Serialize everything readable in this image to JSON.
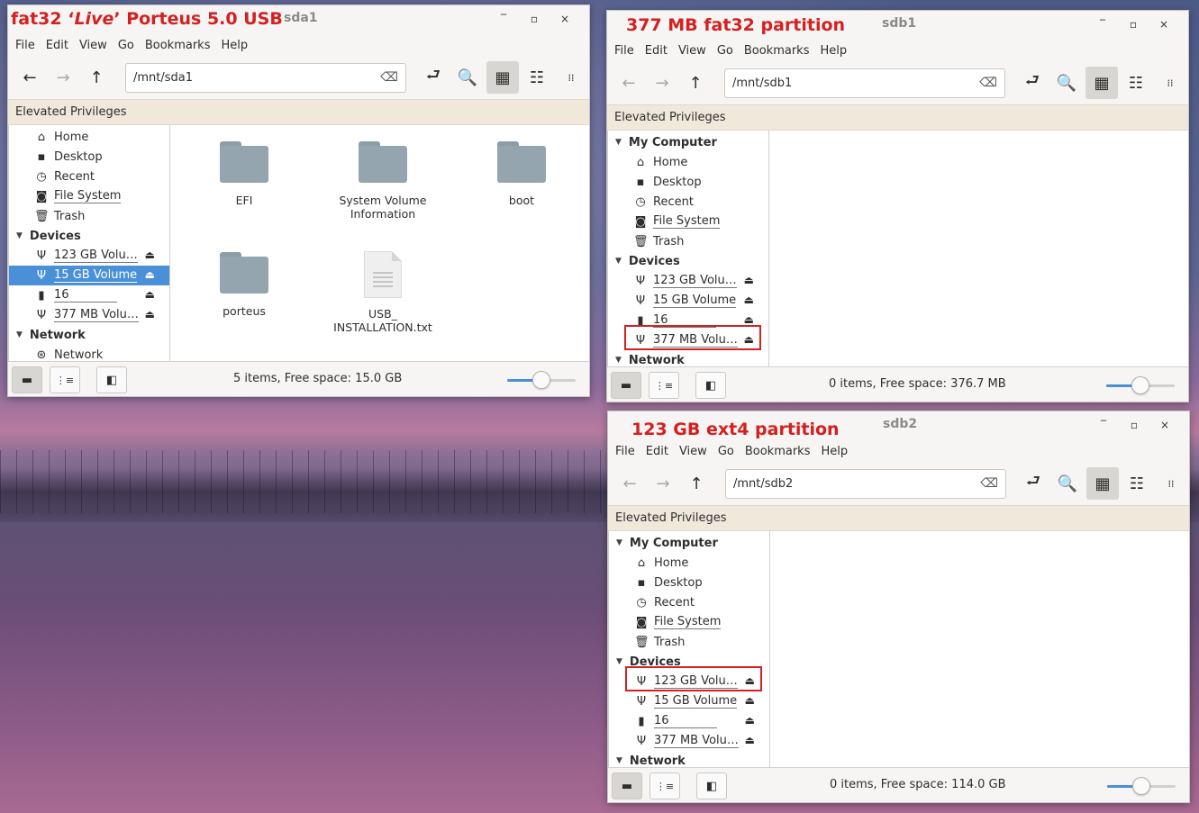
{
  "menu": [
    "File",
    "Edit",
    "View",
    "Go",
    "Bookmarks",
    "Help"
  ],
  "elevated": "Elevated Privileges",
  "icons": {
    "back": "←",
    "forward": "→",
    "up": "↑",
    "toggle_location": "⮐",
    "search": "🔍",
    "icon_view": "▦",
    "list_view": "☷",
    "compact_view": "⁞⁞",
    "home": "⌂",
    "desktop": "▪",
    "recent": "◷",
    "filesystem": "◙",
    "trash": "🗑",
    "usb": "Ψ",
    "drive16": "▮",
    "network": "⊛",
    "eject": "⏏",
    "clear": "⌫",
    "minimize": "‾",
    "maximize": "▫",
    "close": "×",
    "places": "▬",
    "tree": "⋮≡",
    "sidebar_toggle": "◧"
  },
  "win1": {
    "title_pre": "fat32 ‘",
    "title_live": "Live",
    "title_post": "’ Porteus 5.0 USB",
    "subtitle": "sda1",
    "path": "/mnt/sda1",
    "sidebar": {
      "places": [
        "Home",
        "Desktop",
        "Recent",
        "File System",
        "Trash"
      ],
      "devices_header": "Devices",
      "devices": [
        "123 GB Volu…",
        "15 GB Volume",
        "16",
        "377 MB Volu…"
      ],
      "network_header": "Network",
      "network": [
        "Network"
      ]
    },
    "files": [
      "EFI",
      "System Volume Information",
      "boot",
      "porteus",
      "USB_ INSTALLATION.txt"
    ],
    "status": "5 items, Free space: 15.0 GB",
    "zoom": 0.5
  },
  "win2": {
    "title": "377 MB fat32 partition",
    "subtitle": "sdb1",
    "path": "/mnt/sdb1",
    "sidebar": {
      "computer_header": "My Computer",
      "places": [
        "Home",
        "Desktop",
        "Recent",
        "File System",
        "Trash"
      ],
      "devices_header": "Devices",
      "devices": [
        "123 GB Volu…",
        "15 GB Volume",
        "16",
        "377 MB Volu…"
      ],
      "network_header": "Network"
    },
    "status": "0 items, Free space: 376.7 MB",
    "zoom": 0.5
  },
  "win3": {
    "title": "123 GB ext4 partition",
    "subtitle": "sdb2",
    "path": "/mnt/sdb2",
    "sidebar": {
      "computer_header": "My Computer",
      "places": [
        "Home",
        "Desktop",
        "Recent",
        "File System",
        "Trash"
      ],
      "devices_header": "Devices",
      "devices": [
        "123 GB Volu…",
        "15 GB Volume",
        "16",
        "377 MB Volu…"
      ],
      "network_header": "Network"
    },
    "status": "0 items, Free space: 114.0 GB",
    "zoom": 0.5
  }
}
